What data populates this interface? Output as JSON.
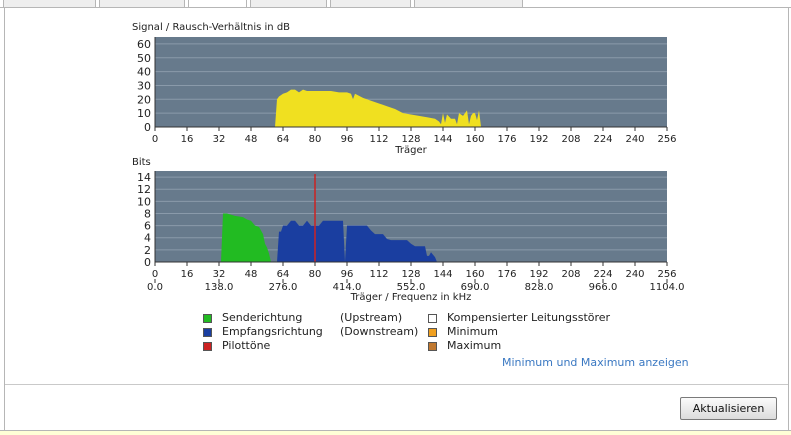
{
  "chart_data": [
    {
      "type": "area",
      "title": "Signal / Rausch-Verhältnis in dB",
      "xlabel": "Träger",
      "ylabel": "",
      "xlim": [
        0,
        256
      ],
      "ylim": [
        0,
        65
      ],
      "x_ticks": [
        0,
        16,
        32,
        48,
        64,
        80,
        96,
        112,
        128,
        144,
        160,
        176,
        192,
        208,
        224,
        240,
        256
      ],
      "y_ticks": [
        0,
        10,
        20,
        30,
        40,
        50,
        60
      ],
      "series": [
        {
          "color": "#f0e020",
          "x": [
            60,
            61,
            62,
            64,
            66,
            68,
            70,
            72,
            74,
            76,
            78,
            80,
            84,
            88,
            92,
            96,
            98,
            99,
            100,
            104,
            108,
            112,
            116,
            120,
            124,
            128,
            132,
            136,
            140,
            142,
            143,
            144,
            145,
            146,
            148,
            150,
            151,
            152,
            154,
            156,
            157,
            158,
            159,
            160,
            161,
            162,
            163
          ],
          "values": [
            0,
            20,
            22,
            24,
            25,
            27,
            27,
            25,
            27,
            26,
            26,
            26,
            26,
            26,
            25,
            25,
            24,
            20,
            24,
            21,
            19,
            17,
            15,
            13,
            10,
            9,
            8,
            7,
            6,
            4,
            2,
            10,
            3,
            9,
            6,
            6,
            2,
            10,
            8,
            12,
            2,
            8,
            10,
            10,
            5,
            12,
            0
          ]
        }
      ]
    },
    {
      "type": "area",
      "title": "Bits",
      "xlabel": "Träger / Frequenz in kHz",
      "ylabel": "",
      "xlim": [
        0,
        256
      ],
      "ylim": [
        0,
        15
      ],
      "x_ticks": [
        0,
        16,
        32,
        48,
        64,
        80,
        96,
        112,
        128,
        144,
        160,
        176,
        192,
        208,
        224,
        240,
        256
      ],
      "x_ticks_freq": [
        "0.0",
        "138.0",
        "276.0",
        "414.0",
        "552.0",
        "690.0",
        "828.0",
        "966.0",
        "1104.0"
      ],
      "y_ticks": [
        0,
        2,
        4,
        6,
        8,
        10,
        12,
        14
      ],
      "series": [
        {
          "name": "Senderichtung",
          "color": "#22bb22",
          "x": [
            33,
            34,
            36,
            40,
            44,
            46,
            48,
            50,
            52,
            54,
            55,
            56,
            57,
            58
          ],
          "values": [
            0,
            8,
            8,
            7.6,
            7.4,
            7,
            6.8,
            6,
            5.8,
            4.6,
            3,
            2.4,
            1.4,
            0
          ]
        },
        {
          "name": "Empfangsrichtung",
          "color": "#1a3ea0",
          "x": [
            61,
            62,
            63,
            64,
            66,
            68,
            70,
            72,
            74,
            76,
            78,
            80,
            82,
            84,
            86,
            88,
            90,
            92,
            94,
            95,
            96,
            97,
            98,
            100,
            102,
            104,
            106,
            108,
            110,
            112,
            114,
            116,
            118,
            120,
            122,
            124,
            126,
            128,
            130,
            132,
            134,
            135,
            136,
            137,
            138,
            140,
            141
          ],
          "values": [
            0,
            5,
            5,
            6,
            6,
            6.8,
            6.8,
            6,
            6,
            6.8,
            6,
            6,
            6,
            6.8,
            6.8,
            6.8,
            6.8,
            6.8,
            6.8,
            0,
            6,
            6,
            6,
            6,
            6,
            6,
            6,
            5.2,
            4.6,
            4.6,
            4.6,
            3.8,
            3.6,
            3.6,
            3.6,
            3.6,
            3.6,
            3,
            2.6,
            2.6,
            2.6,
            2.6,
            1,
            1,
            1.6,
            0.8,
            0
          ]
        },
        {
          "name": "Pilottöne",
          "color": "#cc2222",
          "x": [
            80
          ],
          "values": [
            14.5
          ]
        }
      ]
    }
  ],
  "legend": [
    {
      "label": "Senderichtung",
      "note": "(Upstream)",
      "color": "#22bb22"
    },
    {
      "label": "Empfangsrichtung",
      "note": "(Downstream)",
      "color": "#1a3ea0"
    },
    {
      "label": "Pilottöne",
      "note": "",
      "color": "#cc2222"
    },
    {
      "label": "Kompensierter Leitungsstörer",
      "color": "#ffffff"
    },
    {
      "label": "Minimum",
      "color": "#f0a020"
    },
    {
      "label": "Maximum",
      "color": "#c07830"
    }
  ],
  "show_minmax_link": "Minimum und Maximum anzeigen",
  "refresh_button": "Aktualisieren",
  "colors": {
    "plot_bg": "#677a8c",
    "grid": "#8a9aaa",
    "link": "#3a78c2"
  }
}
